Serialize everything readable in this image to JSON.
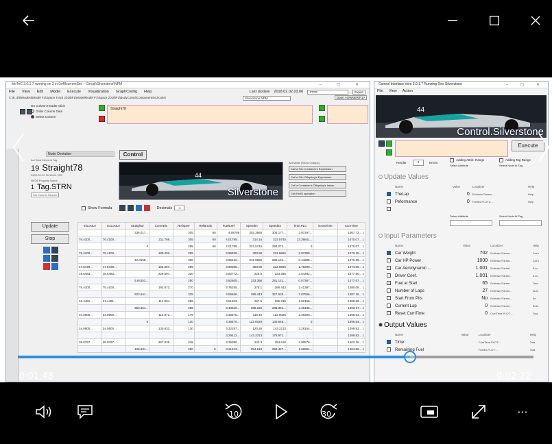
{
  "player": {
    "current_time": "0:01:48",
    "total_time": "0:02:22",
    "progress": 0.7606
  },
  "icons": {
    "back": "back-arrow-icon",
    "minimize": "minimize-icon",
    "maximize": "maximize-icon",
    "close": "close-icon",
    "volume": "volume-icon",
    "captions": "captions-icon",
    "skip_back": "skip-back-10-icon",
    "play": "play-icon",
    "skip_forward": "skip-forward-30-icon",
    "mini_view": "mini-view-icon",
    "full_screen": "full-screen-icon",
    "more": "more-icon"
  },
  "controls": {
    "skip_back_label": "10",
    "skip_forward_label": "30",
    "more_label": "···"
  },
  "left_app": {
    "title": "MoTeC 3.0.1.7 running on 3 in 0x4ffcurrentSet  -- Circuit\\Silverstone\\NPM",
    "menu": [
      "File",
      "View",
      "Edit",
      "Model",
      "Execute",
      "Visualization",
      "GraphConfig",
      "Help"
    ],
    "last_update_label": "Last Update",
    "last_update_value": "2018.02.02.03.06",
    "search_value": "1TYR",
    "expand_label": "Expan",
    "model_path": "C:\\8_3\\5\\Modest\\Model F1\\Space Track 2018\\F1\\ModelModel F1\\Space 2018\\F1\\BodyComp\\Components\\Circuits\\",
    "file_input": "Silverstone.NPM",
    "open_btn": "Open <OWNER/F1>",
    "radio_title": "On Column Header Click",
    "radio_opt1": "Order Column Data",
    "radio_opt2": "Select Column",
    "formula_text": "Straight78",
    "name_label": "Node Deviation",
    "control_btn": "Control",
    "element_tag_label": "Act Stud  Element Tag",
    "id_number": "19",
    "id_name": "Straight78",
    "id_sub": "2020-02-22 15:16:01.7RE",
    "prop_label": "NFO8      Property Name",
    "tag_number": "1",
    "tag_name": "Tag.STRN",
    "set_column_header": "Set Column Header",
    "silverstone_text": "Silverstone",
    "side_title": "Act Mode (Show Groups)",
    "side_btns": [
      "Call a S/Io Container's Expression",
      "Call a S/Io Offspring's Expression",
      "Call a Container's Offspring's Instan",
      "Call Hst/S operation"
    ],
    "show_formula": "Show Formula",
    "decimals_label": "Decimals",
    "decimals_value": "1",
    "update_btn": "Update",
    "stop_btn": "Stop",
    "table_headers": [
      "IniLostLe",
      "ExLostLe",
      "StraightD",
      "CurveDis",
      "RefSpee",
      "RefBreak",
      "FuelExFl",
      "SpeedIn",
      "SpeedEx",
      "Time.FLC",
      "ExtraTime",
      "CumTime"
    ],
    "table_rows": [
      [
        "",
        "",
        "336.017...",
        "",
        "305",
        "60",
        "4.08786",
        "302.3565",
        "305.177...",
        "3.97297...",
        "",
        "1367.72... 1"
      ],
      [
        "76.4100...",
        "76.4100...",
        "",
        "211.768...",
        "305",
        "60",
        "4.01789...",
        "314.16",
        "323.5745",
        "23.36641...",
        "",
        "1570.07... 1"
      ],
      [
        "",
        "",
        "0",
        "",
        "295",
        "60",
        "4.01789...",
        "323.5745",
        "293.074...",
        "0",
        "",
        "1570.07... 1"
      ],
      [
        "75.4100...",
        "75.4100...",
        "",
        "180.292...",
        "295",
        "",
        "3.95829...",
        "303.85",
        "312.9655",
        "2.07308...",
        "",
        "1372.15... 1"
      ],
      [
        "",
        "",
        "12.0158...",
        "",
        "300",
        "",
        "3.95432...",
        "312.9655",
        "299.124...",
        "0.14295...",
        "",
        "1372.29... 1"
      ],
      [
        "47.5729...",
        "47.5729...",
        "",
        "153.257...",
        "295",
        "",
        "3.90365...",
        "303.85",
        "312.9655",
        "1.76299...",
        "",
        "1374.05... 1"
      ],
      [
        "18.5483...",
        "18.5483...",
        "",
        "229.697...",
        "320",
        "",
        "3.82772...",
        "226.6",
        "233.366",
        "3.54282...",
        "",
        "1377.60... 1"
      ],
      [
        "",
        "",
        "5.84152...",
        "",
        "250",
        "",
        "3.82605...",
        "233.366",
        "251.121...",
        "0.07367...",
        "",
        "1377.67... 1"
      ],
      [
        "75.4100...",
        "75.4100...",
        "",
        "192.073...",
        "270",
        "",
        "3.76255...",
        "278.1",
        "286.443",
        "2.41397...",
        "",
        "1380.09... 1"
      ],
      [
        "",
        "",
        "623.641...",
        "",
        "325",
        "",
        "3.55636...",
        "286.443",
        "327.625...",
        "7.07506...",
        "",
        "1387.16... 1"
      ],
      [
        "31.4481...",
        "31.4481...",
        "",
        "112.094...",
        "285",
        "",
        "3.51933...",
        "267.5",
        "265.235",
        "1.52156...",
        "",
        "1388.69... 1"
      ],
      [
        "",
        "",
        "350.661...",
        "",
        "285",
        "",
        "3.40340...",
        "265.225",
        "286.351...",
        "4.49135...",
        "",
        "1393.17... 1"
      ],
      [
        "34.0900...",
        "34.0900...",
        "",
        "113.971...",
        "175",
        "",
        "3.36570...",
        "118.46",
        "122.0026",
        "3.36300...",
        "",
        "1396.54... 1"
      ],
      [
        "",
        "",
        "0",
        "",
        "130",
        "",
        "3.36570...",
        "122.0026",
        "130.546...",
        "0",
        "",
        "1396.54... 1"
      ],
      [
        "34.0900...",
        "34.0900...",
        "",
        "130.832...",
        "130",
        "",
        "3.32257...",
        "120.26",
        "143.2213",
        "3.28154...",
        "",
        "1399.82... 1"
      ],
      [
        "",
        "",
        "",
        "",
        "",
        "",
        "3.29412...",
        "143.2213",
        "178.971...",
        "",
        "",
        "1399.82... 1"
      ],
      [
        "38.0797...",
        "38.0797...",
        "",
        "267.035...",
        "245",
        "",
        "3.25390...",
        "242.3",
        "254.618",
        "2.90576...",
        "",
        "1402.15... 1"
      ],
      [
        "",
        "",
        "126.631...",
        "",
        "290",
        "0",
        "3.21213...",
        "254.618",
        "292.427...",
        "1.66501...",
        "",
        "1404.56... 1"
      ]
    ]
  },
  "right_app": {
    "title": "Control Interface  Vers 3.0.1.7 Running Ons Silverstone",
    "menu": [
      "File",
      "View",
      "Action"
    ],
    "banner_text": "Control.Silverstone",
    "execute_btn": "Execute",
    "render_label": "Render",
    "render_value": "0",
    "errors_label": "Errors",
    "adding_attr": "Adding Attrib. Range",
    "adding_tag": "Adding Tag Range",
    "select_attr": "Select Attribute",
    "select_node": "Select Node At Tag",
    "update_values": "Update Values",
    "input_parameters": "Input Parameters",
    "output_values": "Output Values",
    "col_name": "Name",
    "col_value": "Value",
    "col_location": "Localizer",
    "col_help": "Help",
    "update_rows": [
      {
        "name": "TheLap",
        "value": "0",
        "loc": "Extrinsic Param...",
        "help": "Help"
      },
      {
        "name": "Peformance",
        "value": "0",
        "loc": "FuelEx.PLOT2:...",
        "help": "Help"
      },
      {
        "name": "",
        "value": "",
        "loc": "",
        "help": ""
      }
    ],
    "input_rows": [
      {
        "name": "Car Weight",
        "value": "702",
        "loc": "Extrinsic Param...",
        "help": "Car's"
      },
      {
        "name": "Car HP Power",
        "value": "1000",
        "loc": "Extrinsic Param...",
        "help": "Car's"
      },
      {
        "name": "Car Aerodynamic ...",
        "value": "1.001",
        "loc": "Extrinsic Param...",
        "help": "A co"
      },
      {
        "name": "Driver Coef.",
        "value": "1.001",
        "loc": "Extrinsic Param...",
        "help": "A co"
      },
      {
        "name": "Fuel at Start",
        "value": "65",
        "loc": "Extrinsic Param...",
        "help": "Tota"
      },
      {
        "name": "Number of Laps",
        "value": "27",
        "loc": "Extrinsic Param...",
        "help": "Num"
      },
      {
        "name": "Start From Pits",
        "value": "No",
        "loc": "Extrinsic Param...",
        "help": "Se"
      },
      {
        "name": "Current Lap",
        "value": "0",
        "loc": "Extrinsic Param...",
        "help": "Refe"
      },
      {
        "name": "Reset CumTime",
        "value": "0",
        "loc": "CumTime.PLOT:...",
        "help": "Tota"
      }
    ],
    "output_rows": [
      {
        "name": "Time",
        "value": "",
        "loc": "CumTime.PLOT:...",
        "help": "Tota"
      },
      {
        "name": "Remaining Fuel",
        "value": "",
        "loc": "FuelEx.PLOT:...",
        "help": "Tota"
      }
    ]
  }
}
